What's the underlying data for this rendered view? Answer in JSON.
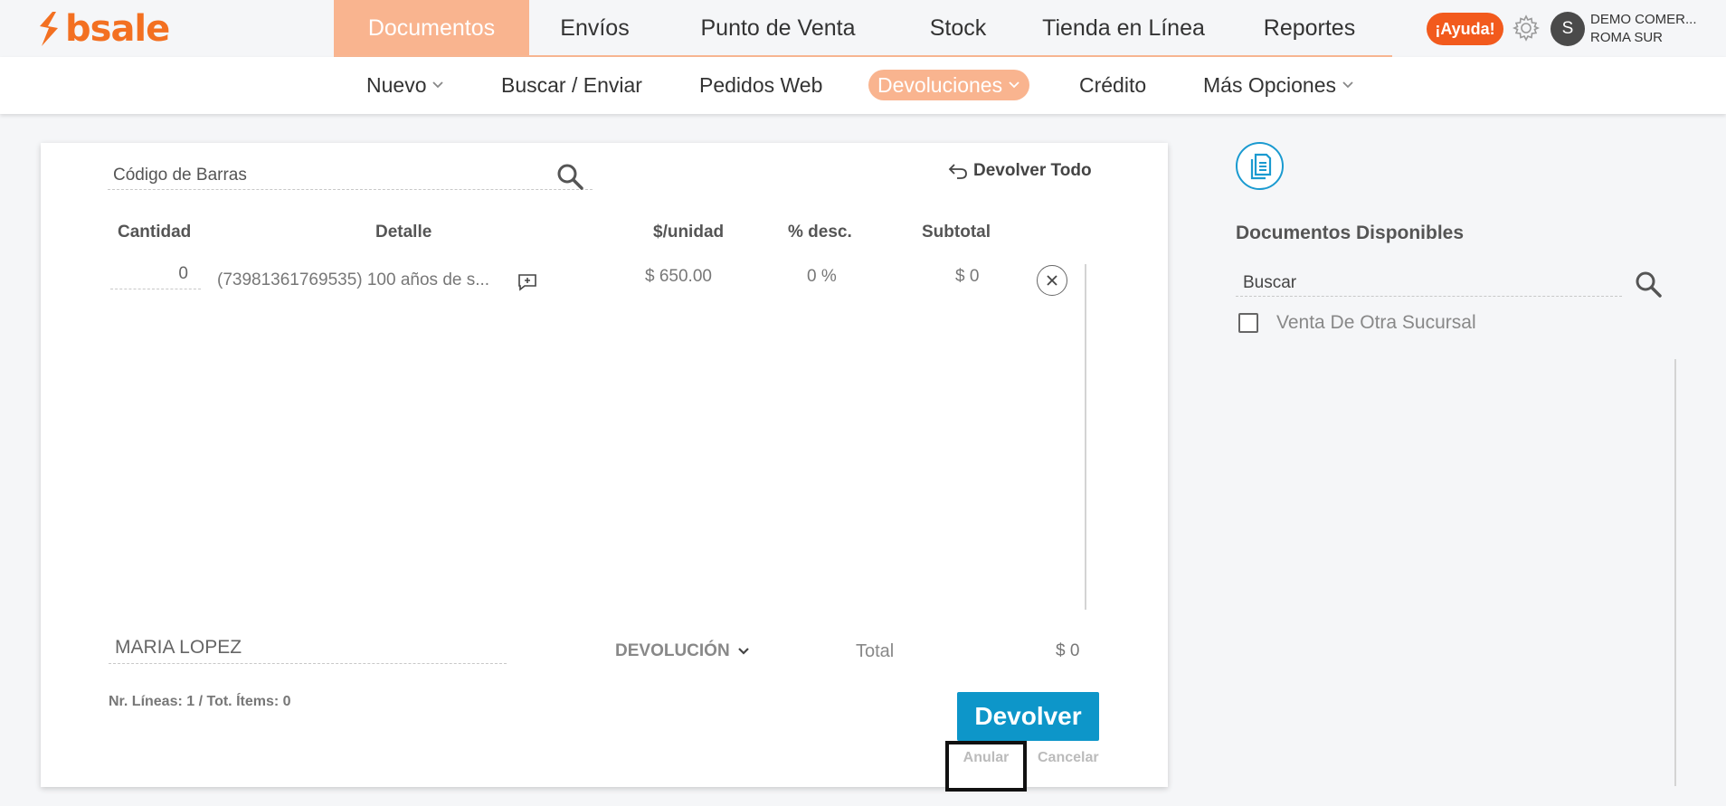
{
  "brand": {
    "name": "bsale",
    "accent": "#f37021"
  },
  "main_nav": {
    "items": [
      {
        "label": "Documentos",
        "active": true
      },
      {
        "label": "Envíos",
        "active": false
      },
      {
        "label": "Punto de Venta",
        "active": false
      },
      {
        "label": "Stock",
        "active": false
      },
      {
        "label": "Tienda en Línea",
        "active": false
      },
      {
        "label": "Reportes",
        "active": false
      }
    ]
  },
  "header": {
    "help_label": "¡Ayuda!",
    "avatar_initial": "S",
    "company": "DEMO COMER...",
    "branch": "ROMA SUR"
  },
  "sub_nav": {
    "items": [
      {
        "label": "Nuevo",
        "dropdown": true
      },
      {
        "label": "Buscar / Enviar",
        "dropdown": false
      },
      {
        "label": "Pedidos Web",
        "dropdown": false
      },
      {
        "label": "Devoluciones",
        "dropdown": true,
        "active": true
      },
      {
        "label": "Crédito",
        "dropdown": false
      },
      {
        "label": "Más Opciones",
        "dropdown": true
      }
    ]
  },
  "form": {
    "barcode_placeholder": "Código de Barras",
    "return_all_label": "Devolver Todo",
    "columns": [
      "Cantidad",
      "Detalle",
      "$/unidad",
      "% desc.",
      "Subtotal"
    ],
    "rows": [
      {
        "quantity": "0",
        "detail": "(73981361769535) 100 años de s...",
        "unit_price": "$ 650.00",
        "discount": "0 %",
        "subtotal": "$ 0"
      }
    ],
    "customer": "MARIA LOPEZ",
    "document_type": "DEVOLUCIÓN",
    "total_label": "Total",
    "total_value": "$ 0",
    "lines_info": "Nr. Líneas: 1 / Tot. Ítems: 0",
    "submit_label": "Devolver",
    "void_label": "Anular",
    "cancel_label": "Cancelar"
  },
  "side_panel": {
    "title": "Documentos Disponibles",
    "search_placeholder": "Buscar",
    "filter_label": "Venta De Otra Sucursal",
    "filter_checked": false
  },
  "colors": {
    "active_tab": "#f9b48f",
    "help_button": "#f25a1d",
    "primary_button": "#0d96c9"
  }
}
